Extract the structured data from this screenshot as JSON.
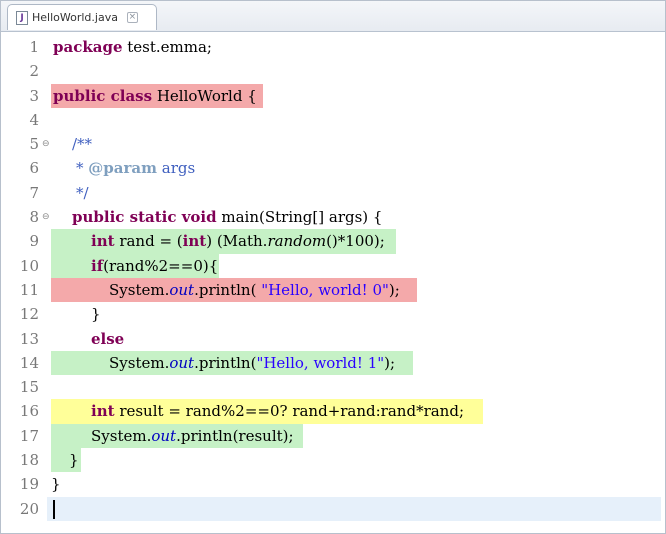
{
  "tab": {
    "file_icon": "java-file-icon",
    "title": "HelloWorld.java",
    "close": "×"
  },
  "lines": [
    {
      "n": "1",
      "t": [
        "package",
        " test.emma;"
      ]
    },
    {
      "n": "2"
    },
    {
      "n": "3",
      "t": [
        "public class",
        " HelloWorld {"
      ]
    },
    {
      "n": "4"
    },
    {
      "n": "5",
      "fold": "⊖",
      "t": [
        "/**"
      ]
    },
    {
      "n": "6",
      "t": [
        "* ",
        "@param",
        " args"
      ]
    },
    {
      "n": "7",
      "t": [
        "*/"
      ]
    },
    {
      "n": "8",
      "fold": "⊖",
      "t": [
        "public static void",
        " main(String[] args) {"
      ]
    },
    {
      "n": "9",
      "t": [
        "int",
        " rand = (",
        "int",
        ") (Math.",
        "random",
        "()*100);"
      ]
    },
    {
      "n": "10",
      "t": [
        "if",
        "(rand%2==0){"
      ]
    },
    {
      "n": "11",
      "t": [
        "System.",
        "out",
        ".println( ",
        "\"Hello, world! 0\"",
        ");"
      ]
    },
    {
      "n": "12",
      "t": [
        "}"
      ]
    },
    {
      "n": "13",
      "t": [
        "else"
      ]
    },
    {
      "n": "14",
      "t": [
        "System.",
        "out",
        ".println(",
        "\"Hello, world! 1\"",
        ");"
      ]
    },
    {
      "n": "15"
    },
    {
      "n": "16",
      "t": [
        "int",
        " result = rand%2==0? rand+rand:rand*rand;"
      ]
    },
    {
      "n": "17",
      "t": [
        "System.",
        "out",
        ".println(result);"
      ]
    },
    {
      "n": "18",
      "t": [
        "}"
      ]
    },
    {
      "n": "19",
      "t": [
        "}"
      ]
    },
    {
      "n": "20"
    }
  ],
  "colors": {
    "uncovered": "#f4a9aa",
    "covered": "#c6f1c6",
    "partial": "#ffff99",
    "current_line": "#e6f0fa",
    "keyword": "#7f0055",
    "string": "#2a00ff",
    "comment": "#3f5fbf"
  }
}
